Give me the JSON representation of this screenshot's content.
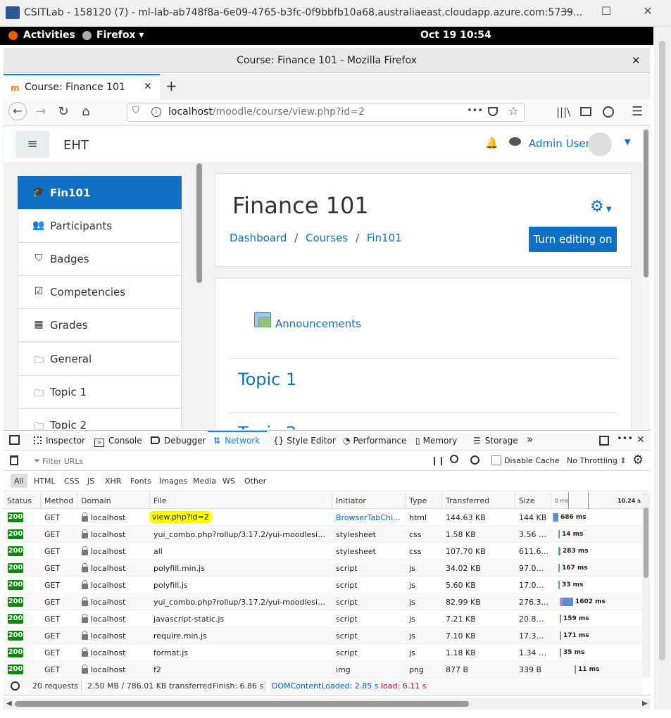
{
  "rdp": {
    "title": "CSITLab - 158120 (7) - ml-lab-ab748f8a-6e09-4765-b3fc-0f9bbfb10a68.australiaeast.cloudapp.azure.com:5739...",
    "minimize": "—",
    "maximize": "☐",
    "close": "✕"
  },
  "gnome": {
    "activities": "Activities",
    "app": "Firefox ▾",
    "clock": "Oct 19  10:54"
  },
  "firefox": {
    "window_title": "Course: Finance 101 - Mozilla Firefox",
    "tab_title": "Course: Finance 101",
    "url_host": "localhost",
    "url_path": "/moodle/course/view.php?id=2",
    "dots": "•••"
  },
  "moodle": {
    "site_name": "EHT",
    "user_name": "Admin User",
    "nav": [
      {
        "label": "Fin101",
        "icon": "graduation-cap-icon",
        "glyph": "🎓"
      },
      {
        "label": "Participants",
        "icon": "users-icon",
        "glyph": "👥"
      },
      {
        "label": "Badges",
        "icon": "shield-icon",
        "glyph": "⛉"
      },
      {
        "label": "Competencies",
        "icon": "checkbox-icon",
        "glyph": "☑"
      },
      {
        "label": "Grades",
        "icon": "table-icon",
        "glyph": "▦"
      },
      {
        "label": "General",
        "icon": "folder-icon",
        "glyph": "🗀"
      },
      {
        "label": "Topic 1",
        "icon": "folder-icon",
        "glyph": "🗀"
      },
      {
        "label": "Topic 2",
        "icon": "folder-icon",
        "glyph": "🗀"
      }
    ],
    "course_title": "Finance 101",
    "breadcrumb": {
      "dashboard": "Dashboard",
      "sep": "/",
      "courses": "Courses",
      "course": "Fin101"
    },
    "edit_button": "Turn editing on",
    "announcements": "Announcements",
    "topic1": "Topic 1",
    "topic2_partial": "Topic 2"
  },
  "devtools": {
    "tabs": [
      "Inspector",
      "Console",
      "Debugger",
      "Network",
      "Style Editor",
      "Performance",
      "Memory",
      "Storage"
    ],
    "active_tab": "Network",
    "more": "»",
    "filter_placeholder": "Filter URLs",
    "disable_cache": "Disable Cache",
    "throttling": "No Throttling ⇕",
    "types": [
      "All",
      "HTML",
      "CSS",
      "JS",
      "XHR",
      "Fonts",
      "Images",
      "Media",
      "WS",
      "Other"
    ],
    "columns": [
      "Status",
      "Method",
      "Domain",
      "File",
      "Initiator",
      "Type",
      "Transferred",
      "Size"
    ],
    "waterfall_ticks": [
      "0 ms",
      "10.24 s"
    ],
    "requests": [
      {
        "status": "200",
        "method": "GET",
        "domain": "localhost",
        "file": "view.php?id=2",
        "initiator": "BrowserTabChild....",
        "type": "html",
        "transferred": "144.63 KB",
        "size": "144 KB",
        "time": "686 ms",
        "start": 0,
        "dur": 0.07
      },
      {
        "status": "200",
        "method": "GET",
        "domain": "localhost",
        "file": "yui_combo.php?rollup/3.17.2/yui-moodlesimple-...",
        "initiator": "stylesheet",
        "type": "css",
        "transferred": "1.58 KB",
        "size": "3.56 KB",
        "time": "14 ms",
        "start": 0.07,
        "dur": 0.002
      },
      {
        "status": "200",
        "method": "GET",
        "domain": "localhost",
        "file": "all",
        "initiator": "stylesheet",
        "type": "css",
        "transferred": "107.70 KB",
        "size": "611.6...",
        "time": "283 ms",
        "start": 0.07,
        "dur": 0.028
      },
      {
        "status": "200",
        "method": "GET",
        "domain": "localhost",
        "file": "polyfill.min.js",
        "initiator": "script",
        "type": "js",
        "transferred": "34.02 KB",
        "size": "97.01 ...",
        "time": "167 ms",
        "start": 0.07,
        "dur": 0.016
      },
      {
        "status": "200",
        "method": "GET",
        "domain": "localhost",
        "file": "polyfill.js",
        "initiator": "script",
        "type": "js",
        "transferred": "5.60 KB",
        "size": "17.09 ...",
        "time": "33 ms",
        "start": 0.07,
        "dur": 0.004
      },
      {
        "status": "200",
        "method": "GET",
        "domain": "localhost",
        "file": "yui_combo.php?rollup/3.17.2/yui-moodlesimple-...",
        "initiator": "script",
        "type": "js",
        "transferred": "82.99 KB",
        "size": "276.3...",
        "time": "1602 ms",
        "start": 0.08,
        "dur": 0.155
      },
      {
        "status": "200",
        "method": "GET",
        "domain": "localhost",
        "file": "javascript-static.js",
        "initiator": "script",
        "type": "js",
        "transferred": "7.21 KB",
        "size": "20.86 ...",
        "time": "159 ms",
        "start": 0.08,
        "dur": 0.016
      },
      {
        "status": "200",
        "method": "GET",
        "domain": "localhost",
        "file": "require.min.js",
        "initiator": "script",
        "type": "js",
        "transferred": "7.10 KB",
        "size": "17.32 ...",
        "time": "171 ms",
        "start": 0.08,
        "dur": 0.017
      },
      {
        "status": "200",
        "method": "GET",
        "domain": "localhost",
        "file": "format.js",
        "initiator": "script",
        "type": "js",
        "transferred": "1.18 KB",
        "size": "1.34 KB",
        "time": "35 ms",
        "start": 0.08,
        "dur": 0.004
      },
      {
        "status": "200",
        "method": "GET",
        "domain": "localhost",
        "file": "f2",
        "initiator": "img",
        "type": "png",
        "transferred": "877 B",
        "size": "339 B",
        "time": "11 ms",
        "start": 0.26,
        "dur": 0.002
      }
    ],
    "summary": {
      "requests": "20 requests",
      "transferred": "2.50 MB / 786.01 KB transferred",
      "finish": "Finish: 6.86 s",
      "dcl": "DOMContentLoaded: 2.85 s",
      "load": "load: 6.11 s"
    },
    "colors": {
      "status_ok": "#058b00",
      "dcl": "#0060df",
      "load": "#d70022",
      "highlight": "#ffff00"
    }
  }
}
